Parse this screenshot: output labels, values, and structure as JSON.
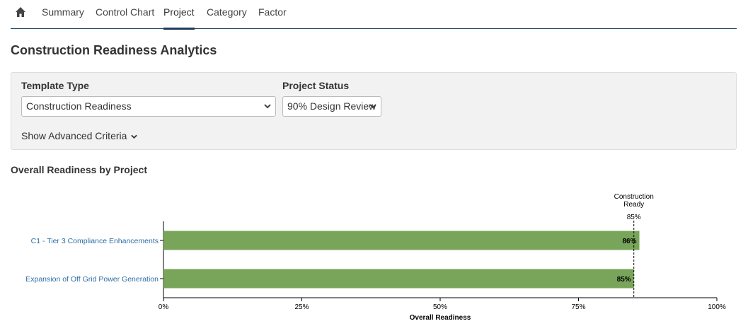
{
  "nav": {
    "home_icon": "home-icon",
    "tabs": [
      {
        "label": "Summary",
        "active": false
      },
      {
        "label": "Control Chart",
        "active": false
      },
      {
        "label": "Project",
        "active": true
      },
      {
        "label": "Category",
        "active": false
      },
      {
        "label": "Factor",
        "active": false
      }
    ]
  },
  "page": {
    "title": "Construction Readiness Analytics"
  },
  "filters": {
    "template_type": {
      "label": "Template Type",
      "value": "Construction Readiness"
    },
    "project_status": {
      "label": "Project Status",
      "value": "90% Design Review"
    },
    "advanced_toggle": "Show Advanced Criteria"
  },
  "section": {
    "title": "Overall Readiness by Project"
  },
  "colors": {
    "bar": "#78a55a",
    "link": "#2e6da4",
    "nav_accent": "#1f3c5a"
  },
  "chart_data": {
    "type": "bar",
    "orientation": "horizontal",
    "categories": [
      "C1 - Tier 3 Compliance Enhancements",
      "Expansion of Off Grid Power Generation"
    ],
    "values": [
      86,
      85
    ],
    "value_labels": [
      "86%",
      "85%"
    ],
    "xlabel": "Overall Readiness",
    "xlim": [
      0,
      100
    ],
    "xticks": [
      "0%",
      "25%",
      "50%",
      "75%",
      "100%"
    ],
    "reference_line": {
      "value": 85,
      "label_line1": "Construction",
      "label_line2": "Ready",
      "value_label": "85%"
    },
    "grid": false
  }
}
